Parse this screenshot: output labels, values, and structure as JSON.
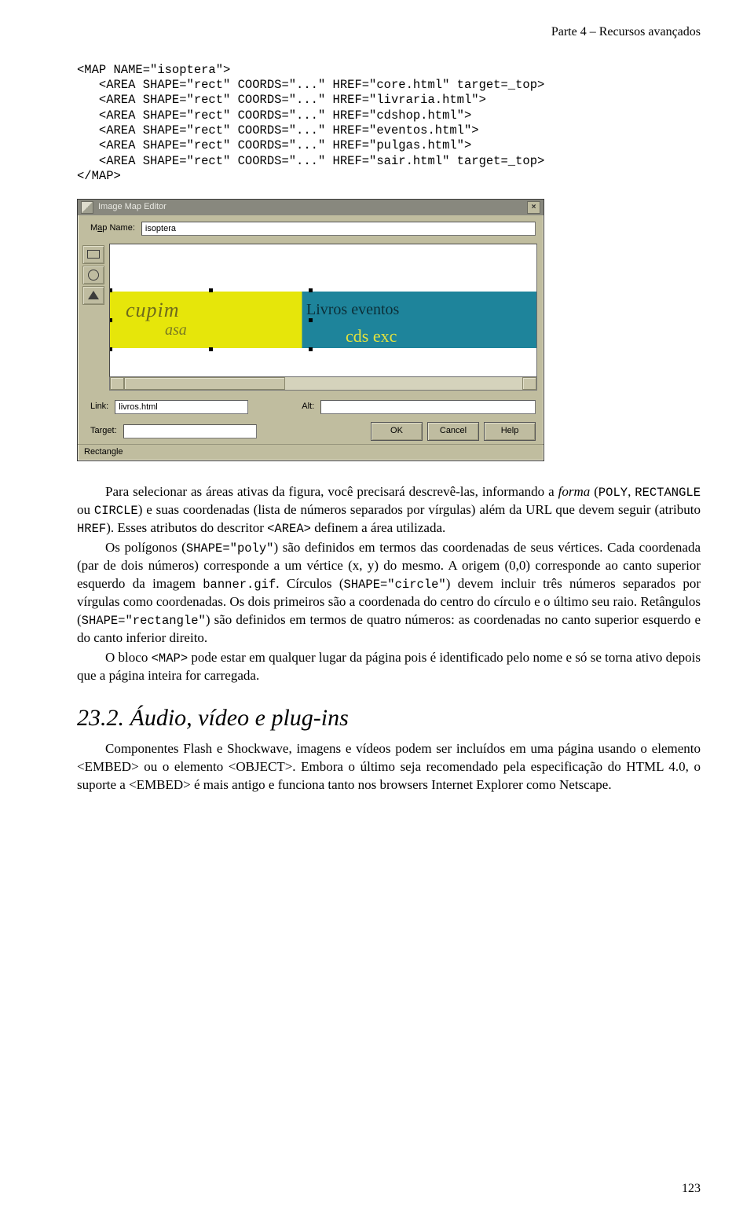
{
  "header": {
    "running_head": "Parte 4 – Recursos avançados"
  },
  "code": {
    "lines": "<MAP NAME=\"isoptera\">\n   <AREA SHAPE=\"rect\" COORDS=\"...\" HREF=\"core.html\" target=_top>\n   <AREA SHAPE=\"rect\" COORDS=\"...\" HREF=\"livraria.html\">\n   <AREA SHAPE=\"rect\" COORDS=\"...\" HREF=\"cdshop.html\">\n   <AREA SHAPE=\"rect\" COORDS=\"...\" HREF=\"eventos.html\">\n   <AREA SHAPE=\"rect\" COORDS=\"...\" HREF=\"pulgas.html\">\n   <AREA SHAPE=\"rect\" COORDS=\"...\" HREF=\"sair.html\" target=_top>\n</MAP>"
  },
  "editor": {
    "title": "Image Map Editor",
    "mapname_label_pre": "M",
    "mapname_label_u": "a",
    "mapname_label_post": "p Name:",
    "mapname_value": "isoptera",
    "banner": {
      "brand1": "cupim",
      "brand2": "asa",
      "r1": "Livros  eventos",
      "r2": "cds        exc"
    },
    "link_label_u": "L",
    "link_label_post": "ink:",
    "link_value": "livros.html",
    "alt_label_pre": "Al",
    "alt_label_u": "t",
    "alt_label_post": ":",
    "alt_value": "",
    "target_label_u": "T",
    "target_label_post": "arget:",
    "target_value": "",
    "btn_ok": "OK",
    "btn_cancel": "Cancel",
    "btn_help": "Help",
    "status": "Rectangle"
  },
  "body_text": {
    "p1_a": "Para selecionar as áreas ativas da figura, você precisará descrevê-las, informando a ",
    "p1_b": "forma",
    "p1_c": " (",
    "p1_d": "POLY",
    "p1_e": ", ",
    "p1_f": "RECTANGLE",
    "p1_g": " ou ",
    "p1_h": "CIRCLE",
    "p1_i": ") e suas coordenadas (lista de números separados por vírgulas) além da URL que devem seguir (atributo ",
    "p1_j": "HREF",
    "p1_k": "). Esses atributos do descritor ",
    "p1_l": "<AREA>",
    "p1_m": " definem a área utilizada.",
    "p2_a": "Os polígonos (",
    "p2_b": "SHAPE=\"poly\"",
    "p2_c": ") são definidos em termos das coordenadas de seus vértices. Cada coordenada (par de dois números) corresponde a um vértice (x, y) do mesmo. A origem (0,0) corresponde ao canto superior esquerdo da imagem ",
    "p2_d": "banner.gif",
    "p2_e": ". Círculos (",
    "p2_f": "SHAPE=\"circle\"",
    "p2_g": ") devem incluir três números separados por vírgulas como coordenadas. Os dois primeiros são a coordenada do centro do círculo e o último seu raio. Retângulos (",
    "p2_h": "SHAPE=\"rectangle\"",
    "p2_i": ") são definidos em termos de quatro números: as coordenadas no canto superior esquerdo e do canto inferior direito.",
    "p3_a": "O bloco ",
    "p3_b": "<MAP>",
    "p3_c": " pode estar em qualquer lugar da página pois é identificado pelo nome e só se torna ativo depois que a página inteira for carregada."
  },
  "heading": "23.2. Áudio, vídeo e plug-ins",
  "body_text2": {
    "p4": "Componentes Flash e Shockwave, imagens e vídeos podem ser incluídos em uma página usando o elemento <EMBED> ou o elemento <OBJECT>. Embora o último seja recomendado pela especificação do HTML 4.0, o suporte a <EMBED> é mais antigo e funciona tanto nos browsers Internet Explorer como Netscape."
  },
  "page_number": "123"
}
